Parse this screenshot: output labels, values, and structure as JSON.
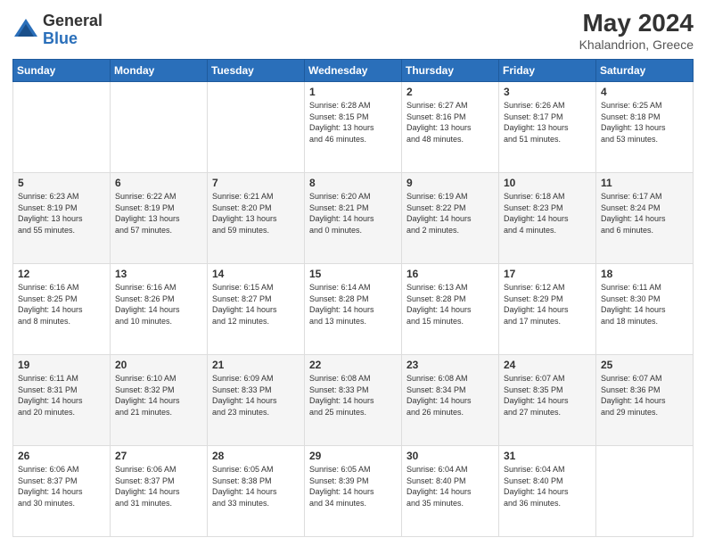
{
  "header": {
    "logo_general": "General",
    "logo_blue": "Blue",
    "month_year": "May 2024",
    "location": "Khalandrion, Greece"
  },
  "days_of_week": [
    "Sunday",
    "Monday",
    "Tuesday",
    "Wednesday",
    "Thursday",
    "Friday",
    "Saturday"
  ],
  "weeks": [
    [
      {
        "day": "",
        "info": ""
      },
      {
        "day": "",
        "info": ""
      },
      {
        "day": "",
        "info": ""
      },
      {
        "day": "1",
        "info": "Sunrise: 6:28 AM\nSunset: 8:15 PM\nDaylight: 13 hours\nand 46 minutes."
      },
      {
        "day": "2",
        "info": "Sunrise: 6:27 AM\nSunset: 8:16 PM\nDaylight: 13 hours\nand 48 minutes."
      },
      {
        "day": "3",
        "info": "Sunrise: 6:26 AM\nSunset: 8:17 PM\nDaylight: 13 hours\nand 51 minutes."
      },
      {
        "day": "4",
        "info": "Sunrise: 6:25 AM\nSunset: 8:18 PM\nDaylight: 13 hours\nand 53 minutes."
      }
    ],
    [
      {
        "day": "5",
        "info": "Sunrise: 6:23 AM\nSunset: 8:19 PM\nDaylight: 13 hours\nand 55 minutes."
      },
      {
        "day": "6",
        "info": "Sunrise: 6:22 AM\nSunset: 8:19 PM\nDaylight: 13 hours\nand 57 minutes."
      },
      {
        "day": "7",
        "info": "Sunrise: 6:21 AM\nSunset: 8:20 PM\nDaylight: 13 hours\nand 59 minutes."
      },
      {
        "day": "8",
        "info": "Sunrise: 6:20 AM\nSunset: 8:21 PM\nDaylight: 14 hours\nand 0 minutes."
      },
      {
        "day": "9",
        "info": "Sunrise: 6:19 AM\nSunset: 8:22 PM\nDaylight: 14 hours\nand 2 minutes."
      },
      {
        "day": "10",
        "info": "Sunrise: 6:18 AM\nSunset: 8:23 PM\nDaylight: 14 hours\nand 4 minutes."
      },
      {
        "day": "11",
        "info": "Sunrise: 6:17 AM\nSunset: 8:24 PM\nDaylight: 14 hours\nand 6 minutes."
      }
    ],
    [
      {
        "day": "12",
        "info": "Sunrise: 6:16 AM\nSunset: 8:25 PM\nDaylight: 14 hours\nand 8 minutes."
      },
      {
        "day": "13",
        "info": "Sunrise: 6:16 AM\nSunset: 8:26 PM\nDaylight: 14 hours\nand 10 minutes."
      },
      {
        "day": "14",
        "info": "Sunrise: 6:15 AM\nSunset: 8:27 PM\nDaylight: 14 hours\nand 12 minutes."
      },
      {
        "day": "15",
        "info": "Sunrise: 6:14 AM\nSunset: 8:28 PM\nDaylight: 14 hours\nand 13 minutes."
      },
      {
        "day": "16",
        "info": "Sunrise: 6:13 AM\nSunset: 8:28 PM\nDaylight: 14 hours\nand 15 minutes."
      },
      {
        "day": "17",
        "info": "Sunrise: 6:12 AM\nSunset: 8:29 PM\nDaylight: 14 hours\nand 17 minutes."
      },
      {
        "day": "18",
        "info": "Sunrise: 6:11 AM\nSunset: 8:30 PM\nDaylight: 14 hours\nand 18 minutes."
      }
    ],
    [
      {
        "day": "19",
        "info": "Sunrise: 6:11 AM\nSunset: 8:31 PM\nDaylight: 14 hours\nand 20 minutes."
      },
      {
        "day": "20",
        "info": "Sunrise: 6:10 AM\nSunset: 8:32 PM\nDaylight: 14 hours\nand 21 minutes."
      },
      {
        "day": "21",
        "info": "Sunrise: 6:09 AM\nSunset: 8:33 PM\nDaylight: 14 hours\nand 23 minutes."
      },
      {
        "day": "22",
        "info": "Sunrise: 6:08 AM\nSunset: 8:33 PM\nDaylight: 14 hours\nand 25 minutes."
      },
      {
        "day": "23",
        "info": "Sunrise: 6:08 AM\nSunset: 8:34 PM\nDaylight: 14 hours\nand 26 minutes."
      },
      {
        "day": "24",
        "info": "Sunrise: 6:07 AM\nSunset: 8:35 PM\nDaylight: 14 hours\nand 27 minutes."
      },
      {
        "day": "25",
        "info": "Sunrise: 6:07 AM\nSunset: 8:36 PM\nDaylight: 14 hours\nand 29 minutes."
      }
    ],
    [
      {
        "day": "26",
        "info": "Sunrise: 6:06 AM\nSunset: 8:37 PM\nDaylight: 14 hours\nand 30 minutes."
      },
      {
        "day": "27",
        "info": "Sunrise: 6:06 AM\nSunset: 8:37 PM\nDaylight: 14 hours\nand 31 minutes."
      },
      {
        "day": "28",
        "info": "Sunrise: 6:05 AM\nSunset: 8:38 PM\nDaylight: 14 hours\nand 33 minutes."
      },
      {
        "day": "29",
        "info": "Sunrise: 6:05 AM\nSunset: 8:39 PM\nDaylight: 14 hours\nand 34 minutes."
      },
      {
        "day": "30",
        "info": "Sunrise: 6:04 AM\nSunset: 8:40 PM\nDaylight: 14 hours\nand 35 minutes."
      },
      {
        "day": "31",
        "info": "Sunrise: 6:04 AM\nSunset: 8:40 PM\nDaylight: 14 hours\nand 36 minutes."
      },
      {
        "day": "",
        "info": ""
      }
    ]
  ]
}
